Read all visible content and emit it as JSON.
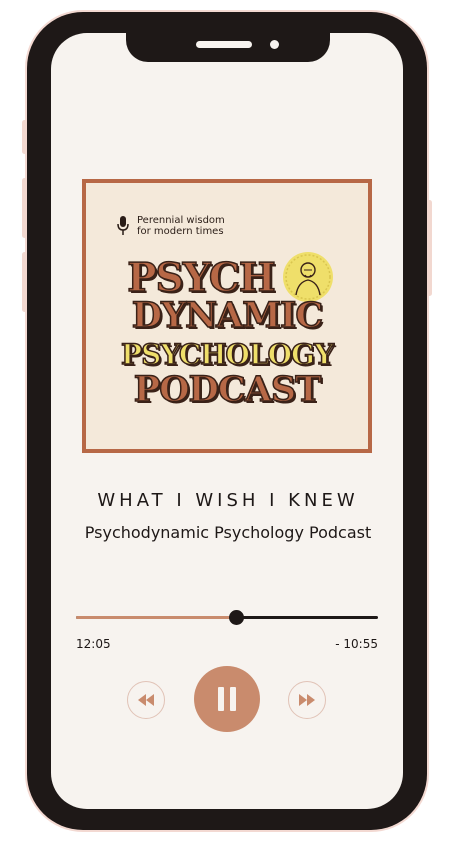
{
  "cover": {
    "tagline": "Perennial wisdom\nfor modern times",
    "words": [
      "PSYCH",
      "DYNAMIC",
      "PSYCHOLOGY",
      "PODCAST"
    ]
  },
  "episode": {
    "title": "WHAT I WISH I KNEW",
    "podcast_name": "Psychodynamic Psychology Podcast"
  },
  "player": {
    "progress": 0.53,
    "elapsed": "12:05",
    "remaining": "- 10:55",
    "state": "playing"
  },
  "colors": {
    "accent": "#c98b6d",
    "brand_brown": "#b76846",
    "brand_yellow": "#efdf6a",
    "dark": "#1e1817"
  }
}
